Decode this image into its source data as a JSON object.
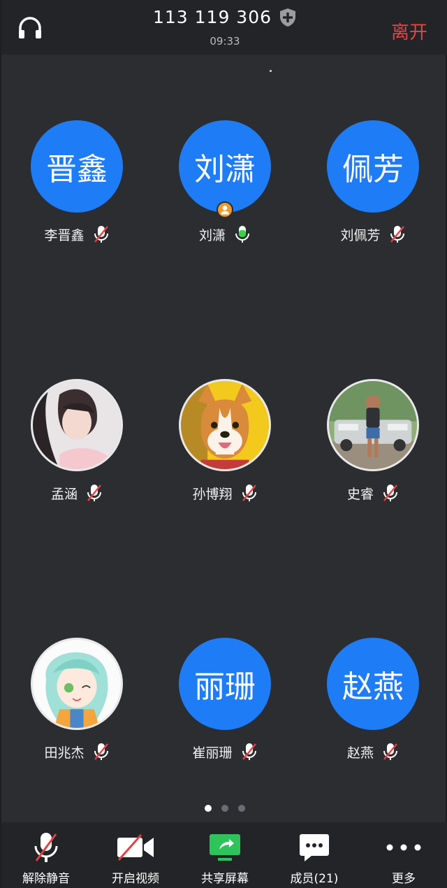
{
  "header": {
    "meeting_id": "113 119 306",
    "time": "09:33",
    "leave_label": "离开"
  },
  "participants": [
    {
      "name": "李晋鑫",
      "avatar_text": "晋鑫",
      "avatar_type": "initials",
      "mic": "muted"
    },
    {
      "name": "刘潇",
      "avatar_text": "刘潇",
      "avatar_type": "initials",
      "mic": "active",
      "host": true
    },
    {
      "name": "刘佩芳",
      "avatar_text": "佩芳",
      "avatar_type": "initials",
      "mic": "muted"
    },
    {
      "name": "孟涵",
      "avatar_type": "photo",
      "photo": "woman-portrait",
      "mic": "muted"
    },
    {
      "name": "孙博翔",
      "avatar_type": "photo",
      "photo": "corgi-dog",
      "mic": "muted"
    },
    {
      "name": "史睿",
      "avatar_type": "photo",
      "photo": "man-with-car",
      "mic": "muted"
    },
    {
      "name": "田兆杰",
      "avatar_type": "photo",
      "photo": "anime-girl",
      "mic": "muted"
    },
    {
      "name": "崔丽珊",
      "avatar_text": "丽珊",
      "avatar_type": "initials",
      "mic": "muted"
    },
    {
      "name": "赵燕",
      "avatar_text": "赵燕",
      "avatar_type": "initials",
      "mic": "muted"
    }
  ],
  "pager": {
    "total": 3,
    "active": 1
  },
  "toolbar": {
    "unmute_label": "解除静音",
    "video_label": "开启视频",
    "share_label": "共享屏幕",
    "members_label": "成员(21)",
    "more_label": "更多"
  },
  "colors": {
    "accent_blue": "#1e7cf6",
    "leave_red": "#e9433f",
    "mic_green": "#3bd14a",
    "mute_red": "#e54040",
    "host_orange": "#f39a2b"
  }
}
